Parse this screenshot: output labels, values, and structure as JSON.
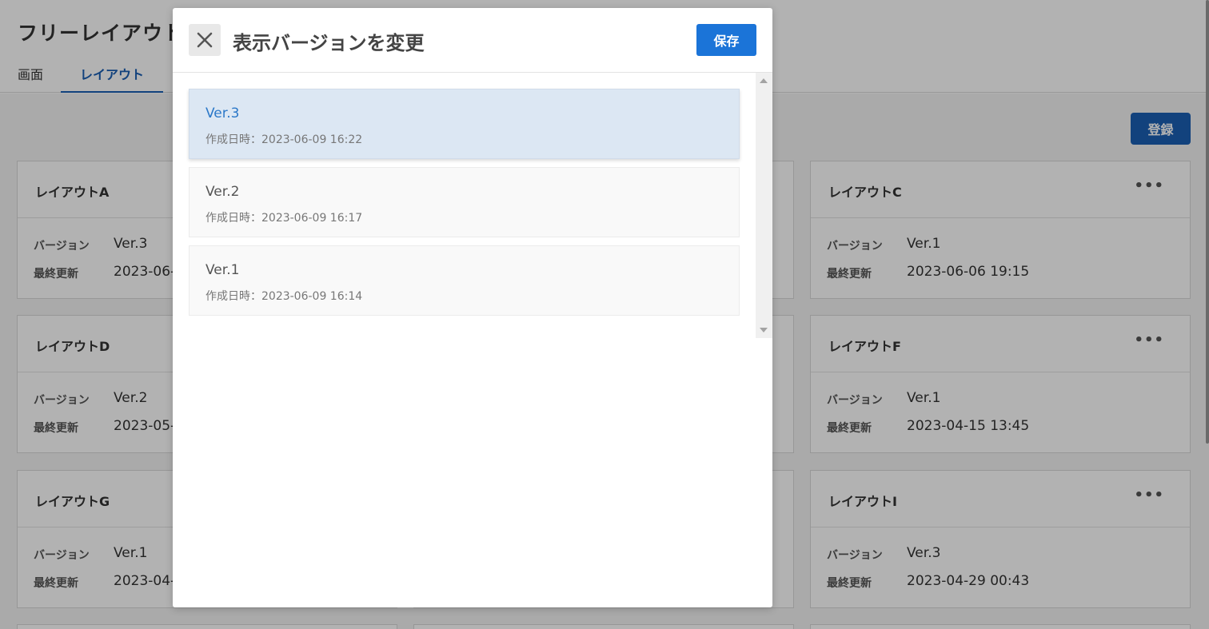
{
  "page": {
    "title": "フリーレイアウト",
    "tabs": [
      {
        "label": "画面"
      },
      {
        "label": "レイアウト"
      }
    ],
    "register_label": "登録",
    "more_icon": "•••",
    "row_labels": {
      "version": "バージョン",
      "updated": "最終更新"
    },
    "cards": [
      {
        "name": "レイアウトA",
        "version": "Ver.3",
        "updated": "2023-06-"
      },
      {
        "name": "レイアウトC",
        "version": "Ver.1",
        "updated": "2023-06-06 19:15"
      },
      {
        "name": "レイアウトD",
        "version": "Ver.2",
        "updated": "2023-05-"
      },
      {
        "name": "レイアウトF",
        "version": "Ver.1",
        "updated": "2023-04-15 13:45"
      },
      {
        "name": "レイアウトG",
        "version": "Ver.1",
        "updated": "2023-04-"
      },
      {
        "name": "レイアウトI",
        "version": "Ver.3",
        "updated": "2023-04-29 00:43"
      }
    ]
  },
  "modal": {
    "title": "表示バージョンを変更",
    "save_label": "保存",
    "versions": [
      {
        "label": "Ver.3",
        "date": "作成日時：2023-06-09 16:22",
        "selected": true
      },
      {
        "label": "Ver.2",
        "date": "作成日時：2023-06-09 16:17",
        "selected": false
      },
      {
        "label": "Ver.1",
        "date": "作成日時：2023-06-09 16:14",
        "selected": false
      }
    ]
  },
  "colors": {
    "primary": "#1b74d8",
    "selected_bg": "#dce7f3",
    "selected_text": "#2b78c8"
  }
}
